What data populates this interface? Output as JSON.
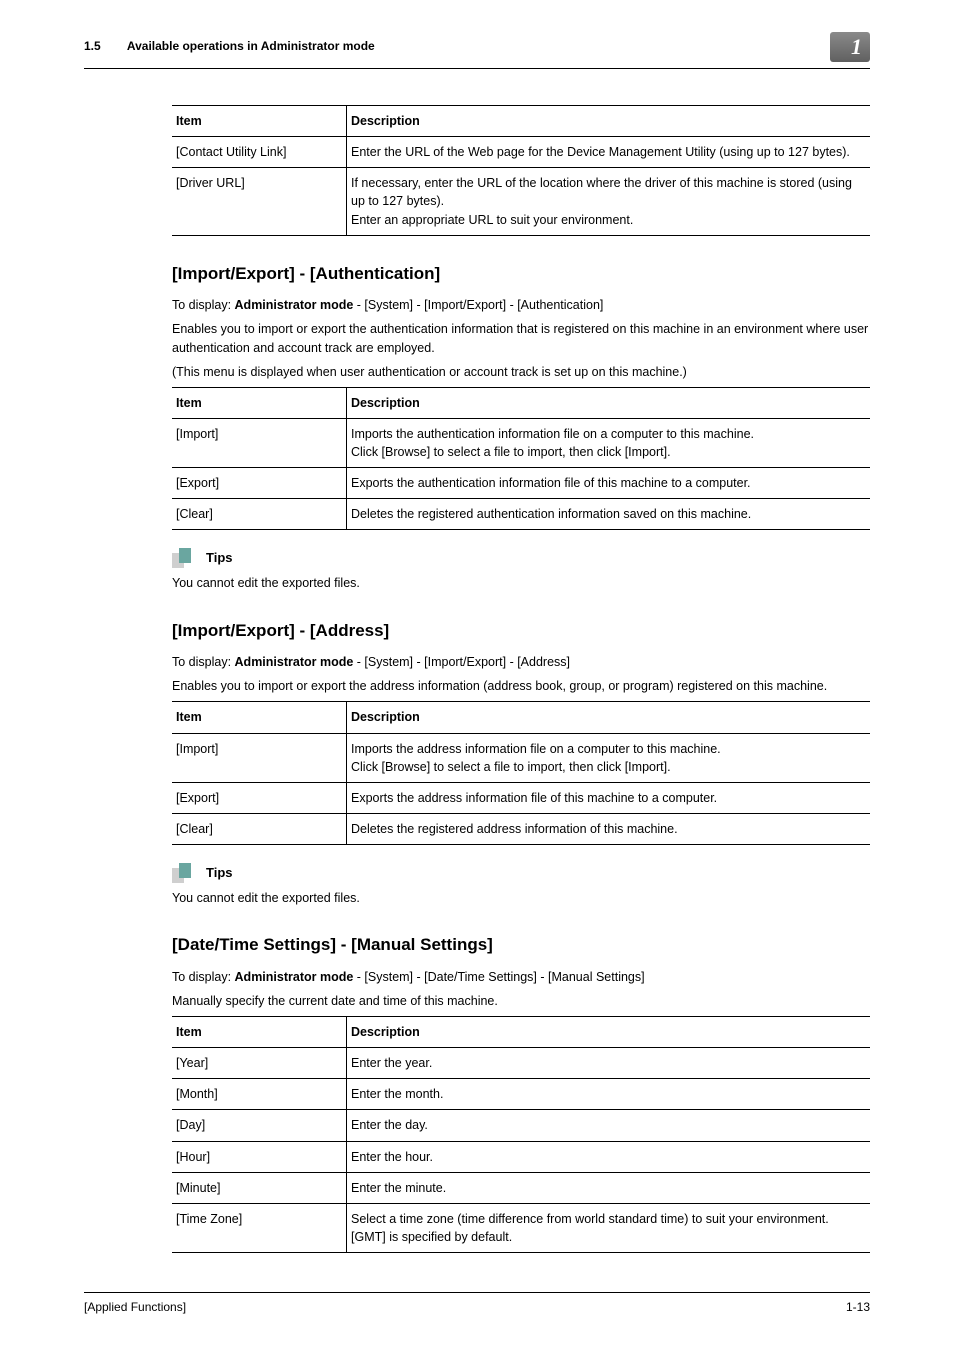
{
  "header": {
    "section_number": "1.5",
    "section_title": "Available operations in Administrator mode",
    "chapter_marker": "1"
  },
  "table_top": {
    "head": {
      "item": "Item",
      "desc": "Description"
    },
    "rows": [
      {
        "item": "[Contact Utility Link]",
        "desc": "Enter the URL of the Web page for the Device Management Utility (using up to 127 bytes)."
      },
      {
        "item": "[Driver URL]",
        "desc": "If necessary, enter the URL of the location where the driver of this machine is stored (using up to 127 bytes).\nEnter an appropriate URL to suit your environment."
      }
    ]
  },
  "sec_auth": {
    "title": "[Import/Export] - [Authentication]",
    "display_prefix": "To display: ",
    "display_bold": "Administrator mode",
    "display_rest": " - [System] - [Import/Export] - [Authentication]",
    "p1": "Enables you to import or export the authentication information that is registered on this machine in an environment where user authentication and account track are employed.",
    "p2": "(This menu is displayed when user authentication or account track is set up on this machine.)",
    "table": {
      "head": {
        "item": "Item",
        "desc": "Description"
      },
      "rows": [
        {
          "item": "[Import]",
          "desc": "Imports the authentication information file on a computer to this machine.\nClick [Browse] to select a file to import, then click [Import]."
        },
        {
          "item": "[Export]",
          "desc": "Exports the authentication information file of this machine to a computer."
        },
        {
          "item": "[Clear]",
          "desc": "Deletes the registered authentication information saved on this machine."
        }
      ]
    },
    "tips_label": "Tips",
    "tips_text": "You cannot edit the exported files."
  },
  "sec_addr": {
    "title": "[Import/Export] - [Address]",
    "display_prefix": "To display: ",
    "display_bold": "Administrator mode",
    "display_rest": " - [System] - [Import/Export] - [Address]",
    "p1": "Enables you to import or export the address information (address book, group, or program) registered on this machine.",
    "table": {
      "head": {
        "item": "Item",
        "desc": "Description"
      },
      "rows": [
        {
          "item": "[Import]",
          "desc": "Imports the address information file on a computer to this machine.\nClick [Browse] to select a file to import, then click [Import]."
        },
        {
          "item": "[Export]",
          "desc": "Exports the address information file of this machine to a computer."
        },
        {
          "item": "[Clear]",
          "desc": "Deletes the registered address information of this machine."
        }
      ]
    },
    "tips_label": "Tips",
    "tips_text": "You cannot edit the exported files."
  },
  "sec_date": {
    "title": "[Date/Time Settings] - [Manual Settings]",
    "display_prefix": "To display: ",
    "display_bold": "Administrator mode",
    "display_rest": " - [System] - [Date/Time Settings] - [Manual Settings]",
    "p1": "Manually specify the current date and time of this machine.",
    "table": {
      "head": {
        "item": "Item",
        "desc": "Description"
      },
      "rows": [
        {
          "item": "[Year]",
          "desc": "Enter the year."
        },
        {
          "item": "[Month]",
          "desc": "Enter the month."
        },
        {
          "item": "[Day]",
          "desc": "Enter the day."
        },
        {
          "item": "[Hour]",
          "desc": "Enter the hour."
        },
        {
          "item": "[Minute]",
          "desc": "Enter the minute."
        },
        {
          "item": "[Time Zone]",
          "desc": "Select a time zone (time difference from world standard time) to suit your environment.\n[GMT] is specified by default."
        }
      ]
    }
  },
  "footer": {
    "left": "[Applied Functions]",
    "right": "1-13"
  }
}
